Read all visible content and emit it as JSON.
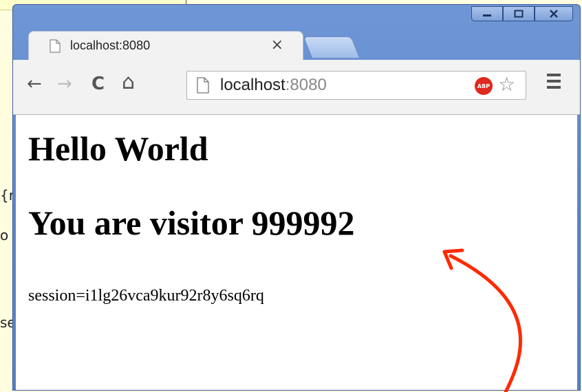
{
  "background": {
    "fragments": [
      "{r",
      "o",
      "se"
    ]
  },
  "window": {
    "controls": [
      "minimize",
      "maximize",
      "close"
    ]
  },
  "tab": {
    "title": "localhost:8080",
    "close_glyph": "×"
  },
  "toolbar": {
    "back": "←",
    "forward": "→",
    "reload": "C",
    "home": "⌂",
    "url_host": "localhost",
    "url_port": ":8080",
    "abp_label": "ABP",
    "star": "☆"
  },
  "page": {
    "heading": "Hello World",
    "visitor": "You are visitor 999992",
    "session": "session=i1lg26vca9kur92r8y6sq6rq"
  },
  "colors": {
    "annotation_arrow": "#ff2a00",
    "window_frame": "#5a84cc",
    "abp_badge": "#e0281e"
  }
}
